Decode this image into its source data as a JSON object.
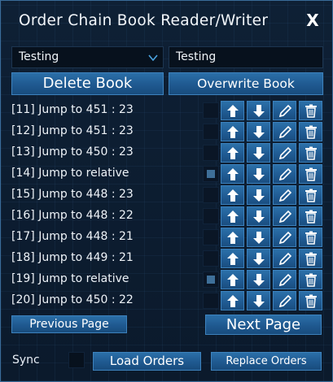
{
  "window": {
    "title": "Order Chain Book Reader/Writer",
    "close_label": "X"
  },
  "book_select": {
    "value": "Testing"
  },
  "book_name_input": {
    "value": "Testing"
  },
  "buttons": {
    "delete_book": "Delete Book",
    "overwrite_book": "Overwrite Book",
    "previous_page": "Previous Page",
    "next_page": "Next Page",
    "load_orders": "Load Orders",
    "replace_orders": "Replace Orders"
  },
  "orders": [
    {
      "label": "[11] Jump to 451 : 23",
      "marked": false
    },
    {
      "label": "[12] Jump to 451 : 23",
      "marked": false
    },
    {
      "label": "[13] Jump to 450 : 23",
      "marked": false
    },
    {
      "label": "[14] Jump to relative",
      "marked": true
    },
    {
      "label": "[15] Jump to 448 : 23",
      "marked": false
    },
    {
      "label": "[16] Jump to 448 : 22",
      "marked": false
    },
    {
      "label": "[17] Jump to 448 : 21",
      "marked": false
    },
    {
      "label": "[18] Jump to 449 : 21",
      "marked": false
    },
    {
      "label": "[19] Jump to relative",
      "marked": true
    },
    {
      "label": "[20] Jump to 450 : 22",
      "marked": false
    }
  ],
  "row_icons": [
    "arrow-up-icon",
    "arrow-down-icon",
    "pencil-icon",
    "trash-icon"
  ],
  "sync": {
    "label": "Sync",
    "checked": false
  },
  "colors": {
    "accent": "#1f5a92",
    "panel": "#0d1d30",
    "text": "#e8eef6"
  }
}
